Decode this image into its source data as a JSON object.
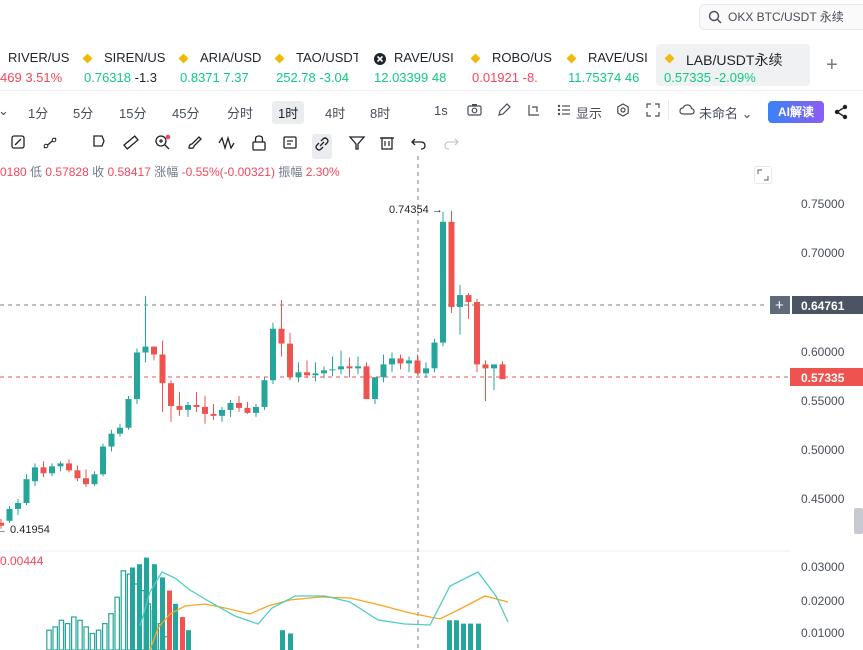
{
  "search": {
    "placeholder": "OKX BTC/USDT 永续"
  },
  "tickers": [
    {
      "name": "RIVER/US",
      "price": "469",
      "change": "3.51%",
      "dir": "neg",
      "icon": "coin-icon"
    },
    {
      "name": "SIREN/US",
      "price": "0.76318",
      "change": "-1.3",
      "dir": "pos",
      "icon": "coin-icon"
    },
    {
      "name": "ARIA/USD",
      "price": "0.8371",
      "change": "7.37",
      "dir": "pos",
      "icon": "coin-icon"
    },
    {
      "name": "TAO/USDT",
      "price": "252.78",
      "change": "-3.04",
      "dir": "pos",
      "icon": "coin-icon"
    },
    {
      "name": "RAVE/USI",
      "price": "12.03399",
      "change": "48",
      "dir": "pos",
      "icon": "cross-coin-icon"
    },
    {
      "name": "ROBO/US",
      "price": "0.01921",
      "change": "-8.",
      "dir": "neg",
      "icon": "coin-icon"
    },
    {
      "name": "RAVE/USI",
      "price": "11.75374",
      "change": "46",
      "dir": "pos",
      "icon": "coin-icon"
    },
    {
      "name": "LAB/USDT永续",
      "price": "0.57335",
      "change": "-2.09%",
      "dir": "pos",
      "icon": "coin-icon",
      "active": true
    }
  ],
  "intervals": [
    "1分",
    "5分",
    "15分",
    "45分",
    "分时",
    "1时",
    "4时",
    "8时"
  ],
  "selected_interval": "1时",
  "toolbar": {
    "seconds": "1s",
    "display": "显示",
    "unnamed": "未命名",
    "ai": "AI解读"
  },
  "info": {
    "open_partial": "0180",
    "low_label": "低",
    "low": "0.57828",
    "close_label": "收",
    "close": "0.58417",
    "change_label": "涨幅",
    "change": "-0.55%(-0.00321)",
    "amp_label": "振幅",
    "amp": "2.30%"
  },
  "price_axis": [
    "0.75000",
    "0.70000",
    "0.65000",
    "0.60000",
    "0.55000",
    "0.50000",
    "0.45000"
  ],
  "crosshair_price": "0.64761",
  "last_price": "0.57335",
  "high_marker": "0.74354 →",
  "low_marker": "← 0.41954",
  "volume_info": "0.00444",
  "volume_axis": [
    "0.03000",
    "0.02000",
    "0.01000"
  ],
  "colors": {
    "up": "#26a69a",
    "down": "#ef5350",
    "ma": "#f5a623",
    "signal": "#4ecdc4"
  }
}
